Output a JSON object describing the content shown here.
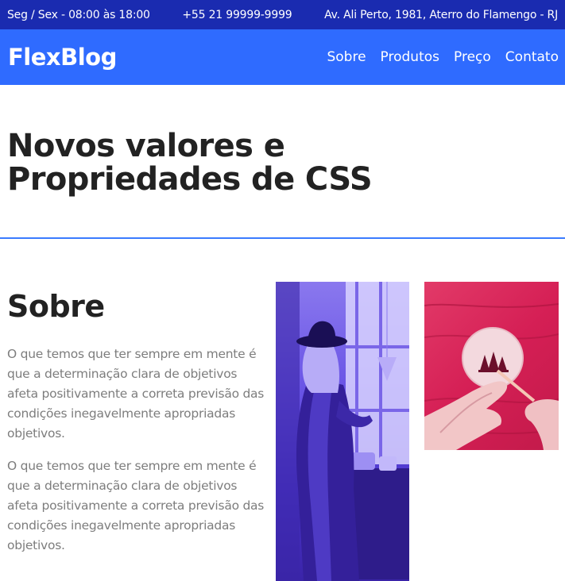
{
  "topbar": {
    "hours": "Seg / Sex - 08:00 às 18:00",
    "phone": "+55 21 99999-9999",
    "address": "Av. Ali Perto, 1981, Aterro do Flamengo - RJ"
  },
  "nav": {
    "logo": "FlexBlog",
    "items": [
      "Sobre",
      "Produtos",
      "Preço",
      "Contato"
    ]
  },
  "hero": {
    "title_line1": "Novos valores e",
    "title_line2": "Propriedades de CSS"
  },
  "about": {
    "title": "Sobre",
    "paragraph1": "O que temos que ter sempre em mente é que a determinação clara de objetivos afeta positivamente a correta previsão das condições inegavelmente apropriadas objetivos.",
    "paragraph2": "O que temos que ter sempre em mente é que a determinação clara de objetivos afeta positivamente a correta previsão das condições inegavelmente apropriadas objetivos."
  },
  "colors": {
    "topbar_bg": "#1a2bb0",
    "navbar_bg": "#2f6bff",
    "accent_line": "#3a7bff",
    "photo1_tint": "#5b45dd",
    "photo2_tint": "#d51f55"
  }
}
